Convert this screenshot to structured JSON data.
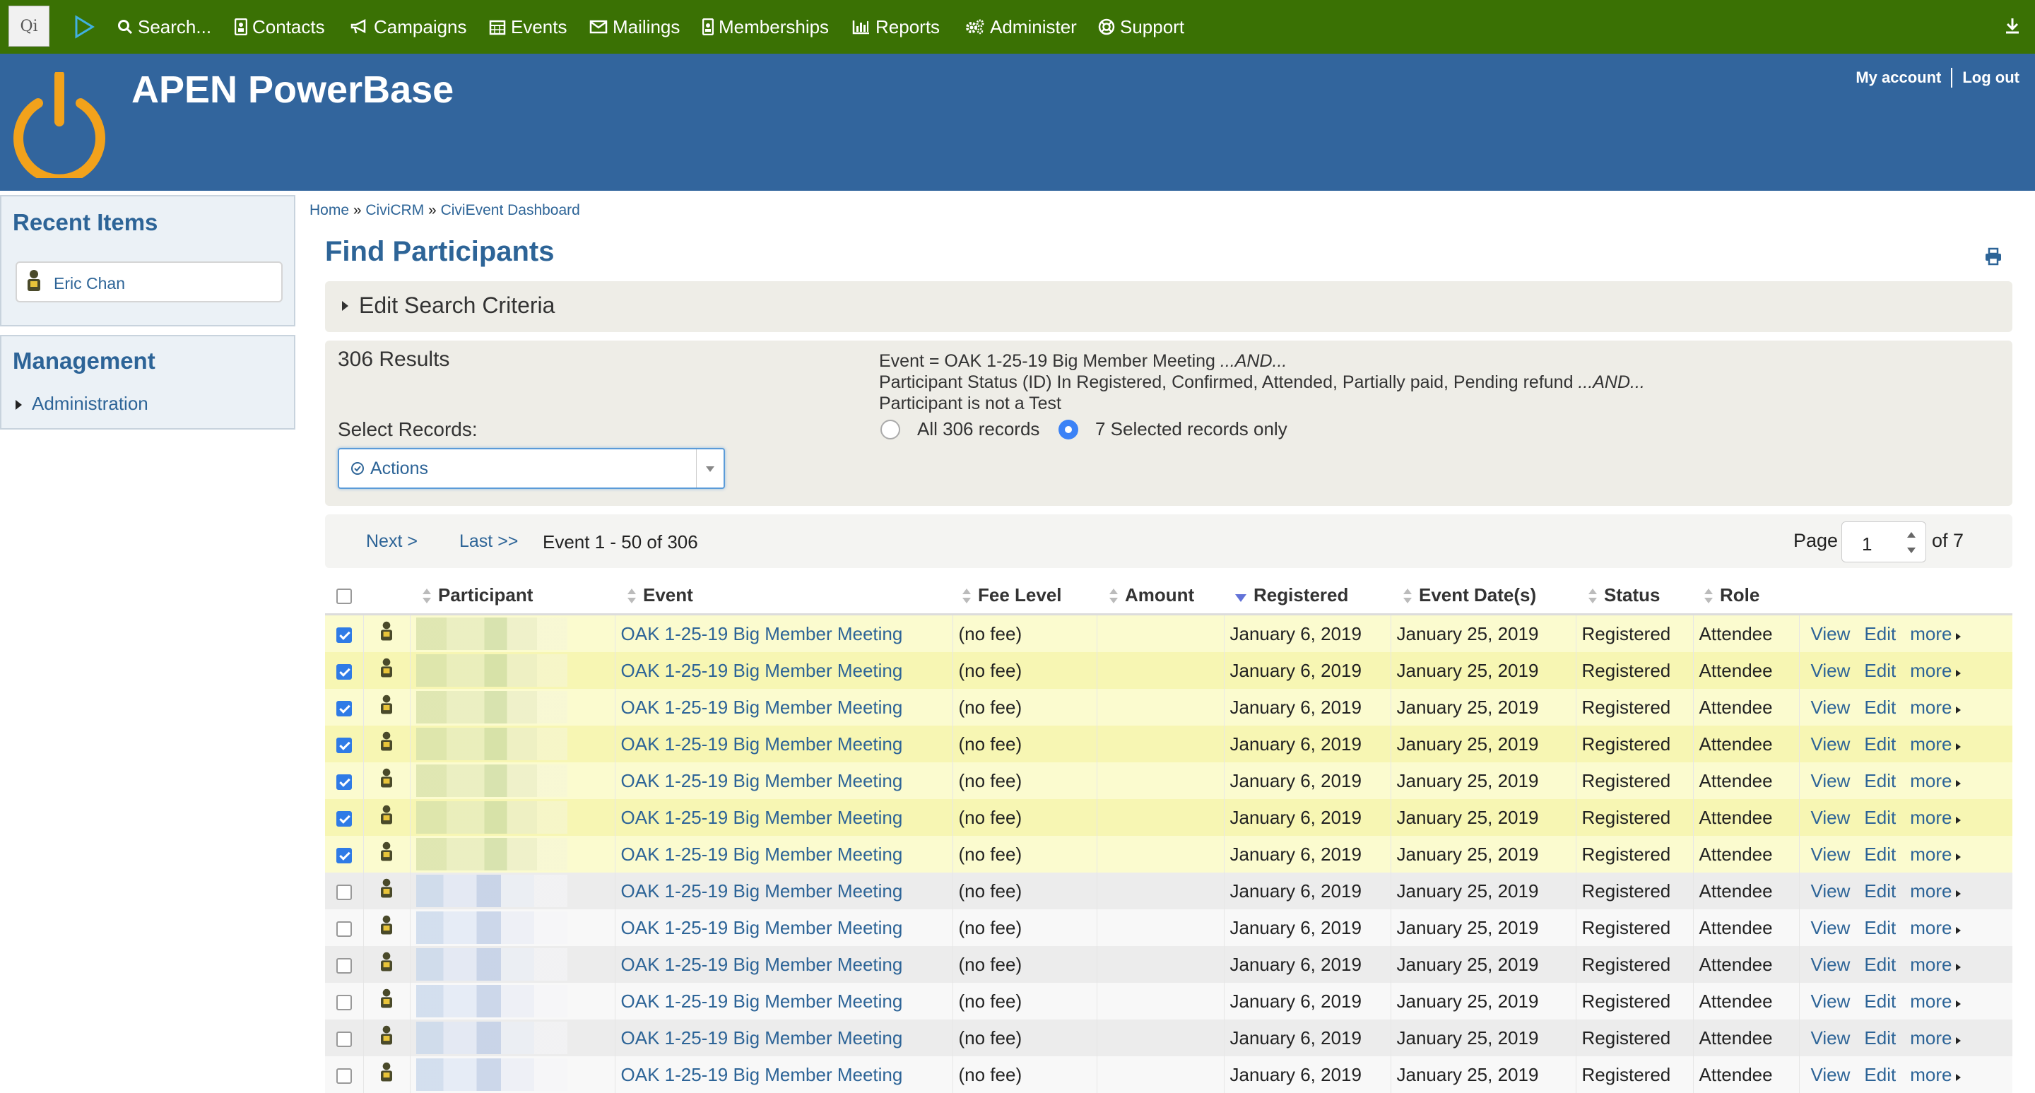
{
  "menubar": {
    "logo_text": "Qi",
    "items": [
      {
        "label": "Search...",
        "icon": "search-icon"
      },
      {
        "label": "Contacts",
        "icon": "contact-card-icon"
      },
      {
        "label": "Campaigns",
        "icon": "bullhorn-icon"
      },
      {
        "label": "Events",
        "icon": "calendar-icon"
      },
      {
        "label": "Mailings",
        "icon": "envelope-icon"
      },
      {
        "label": "Memberships",
        "icon": "id-badge-icon"
      },
      {
        "label": "Reports",
        "icon": "bar-chart-icon"
      },
      {
        "label": "Administer",
        "icon": "gears-icon"
      },
      {
        "label": "Support",
        "icon": "life-ring-icon"
      }
    ],
    "bg_color": "#3a7104"
  },
  "header": {
    "site_title": "APEN PowerBase",
    "my_account": "My account",
    "log_out": "Log out",
    "bg_color": "#32659d"
  },
  "sidebar": {
    "recent_title": "Recent Items",
    "recent_items": [
      {
        "label": "Eric Chan"
      }
    ],
    "management_title": "Management",
    "management_items": [
      {
        "label": "Administration"
      }
    ]
  },
  "breadcrumb": {
    "home": "Home",
    "civicrm": "CiviCRM",
    "dashboard": "CiviEvent Dashboard",
    "sep": " » "
  },
  "page": {
    "title": "Find Participants"
  },
  "criteria": {
    "label": "Edit Search Criteria"
  },
  "results": {
    "count": "306 Results",
    "select_label": "Select Records:",
    "actions_label": "Actions",
    "qill": [
      {
        "text": "Event = OAK 1-25-19 Big Member Meeting ",
        "conj": "...AND..."
      },
      {
        "text": "Participant Status (ID) In Registered, Confirmed, Attended, Partially paid, Pending refund ",
        "conj": "...AND..."
      },
      {
        "text": "Participant is not a Test",
        "conj": ""
      }
    ],
    "radio_all": "All 306 records",
    "radio_selected": "7 Selected records only",
    "selected_option": "selected"
  },
  "pager": {
    "next": "Next >",
    "last": "Last >>",
    "range": "Event 1 - 50 of 306",
    "page_label": "Page",
    "page_value": "1",
    "page_of": "of 7"
  },
  "table": {
    "headers": {
      "participant": "Participant",
      "event": "Event",
      "fee_level": "Fee Level",
      "amount": "Amount",
      "registered": "Registered",
      "event_dates": "Event Date(s)",
      "status": "Status",
      "role": "Role"
    },
    "sorted_column": "registered",
    "actions": {
      "view": "View",
      "edit": "Edit",
      "more": "more"
    },
    "rows": [
      {
        "checked": true,
        "event": "OAK 1-25-19 Big Member Meeting",
        "fee": "(no fee)",
        "amount": "",
        "registered": "January 6, 2019",
        "event_date": "January 25, 2019",
        "status": "Registered",
        "role": "Attendee"
      },
      {
        "checked": true,
        "event": "OAK 1-25-19 Big Member Meeting",
        "fee": "(no fee)",
        "amount": "",
        "registered": "January 6, 2019",
        "event_date": "January 25, 2019",
        "status": "Registered",
        "role": "Attendee"
      },
      {
        "checked": true,
        "event": "OAK 1-25-19 Big Member Meeting",
        "fee": "(no fee)",
        "amount": "",
        "registered": "January 6, 2019",
        "event_date": "January 25, 2019",
        "status": "Registered",
        "role": "Attendee"
      },
      {
        "checked": true,
        "event": "OAK 1-25-19 Big Member Meeting",
        "fee": "(no fee)",
        "amount": "",
        "registered": "January 6, 2019",
        "event_date": "January 25, 2019",
        "status": "Registered",
        "role": "Attendee"
      },
      {
        "checked": true,
        "event": "OAK 1-25-19 Big Member Meeting",
        "fee": "(no fee)",
        "amount": "",
        "registered": "January 6, 2019",
        "event_date": "January 25, 2019",
        "status": "Registered",
        "role": "Attendee"
      },
      {
        "checked": true,
        "event": "OAK 1-25-19 Big Member Meeting",
        "fee": "(no fee)",
        "amount": "",
        "registered": "January 6, 2019",
        "event_date": "January 25, 2019",
        "status": "Registered",
        "role": "Attendee"
      },
      {
        "checked": true,
        "event": "OAK 1-25-19 Big Member Meeting",
        "fee": "(no fee)",
        "amount": "",
        "registered": "January 6, 2019",
        "event_date": "January 25, 2019",
        "status": "Registered",
        "role": "Attendee"
      },
      {
        "checked": false,
        "event": "OAK 1-25-19 Big Member Meeting",
        "fee": "(no fee)",
        "amount": "",
        "registered": "January 6, 2019",
        "event_date": "January 25, 2019",
        "status": "Registered",
        "role": "Attendee"
      },
      {
        "checked": false,
        "event": "OAK 1-25-19 Big Member Meeting",
        "fee": "(no fee)",
        "amount": "",
        "registered": "January 6, 2019",
        "event_date": "January 25, 2019",
        "status": "Registered",
        "role": "Attendee"
      },
      {
        "checked": false,
        "event": "OAK 1-25-19 Big Member Meeting",
        "fee": "(no fee)",
        "amount": "",
        "registered": "January 6, 2019",
        "event_date": "January 25, 2019",
        "status": "Registered",
        "role": "Attendee"
      },
      {
        "checked": false,
        "event": "OAK 1-25-19 Big Member Meeting",
        "fee": "(no fee)",
        "amount": "",
        "registered": "January 6, 2019",
        "event_date": "January 25, 2019",
        "status": "Registered",
        "role": "Attendee"
      },
      {
        "checked": false,
        "event": "OAK 1-25-19 Big Member Meeting",
        "fee": "(no fee)",
        "amount": "",
        "registered": "January 6, 2019",
        "event_date": "January 25, 2019",
        "status": "Registered",
        "role": "Attendee"
      },
      {
        "checked": false,
        "event": "OAK 1-25-19 Big Member Meeting",
        "fee": "(no fee)",
        "amount": "",
        "registered": "January 6, 2019",
        "event_date": "January 25, 2019",
        "status": "Registered",
        "role": "Attendee"
      }
    ]
  }
}
